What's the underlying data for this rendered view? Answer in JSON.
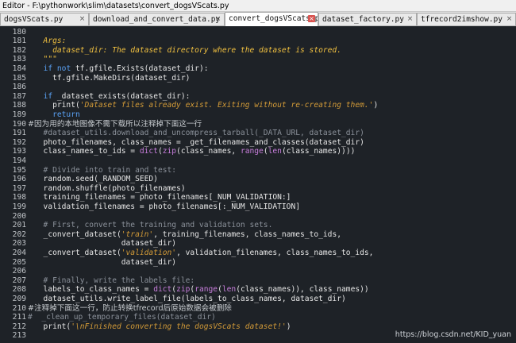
{
  "window": {
    "title": "Editor - F:\\pythonwork\\slim\\datasets\\convert_dogsVScats.py"
  },
  "tabs": [
    {
      "label": "dogsVScats.py",
      "active": false
    },
    {
      "label": "download_and_convert_data.py",
      "active": false
    },
    {
      "label": "convert_dogsVScats.py",
      "active": true
    },
    {
      "label": "dataset_factory.py",
      "active": false
    },
    {
      "label": "tfrecord2imshow.py",
      "active": false
    }
  ],
  "lines": [
    {
      "n": "180",
      "t": ""
    },
    {
      "n": "181",
      "t": "  Args:"
    },
    {
      "n": "182",
      "t": "    dataset_dir: The dataset directory where the dataset is stored."
    },
    {
      "n": "183",
      "t": "  \"\"\""
    },
    {
      "n": "184",
      "t": "  if not tf.gfile.Exists(dataset_dir):"
    },
    {
      "n": "185",
      "t": "    tf.gfile.MakeDirs(dataset_dir)"
    },
    {
      "n": "186",
      "t": ""
    },
    {
      "n": "187",
      "t": "  if _dataset_exists(dataset_dir):"
    },
    {
      "n": "188",
      "t": "    print('Dataset files already exist. Exiting without re-creating them.')"
    },
    {
      "n": "189",
      "t": "    return"
    },
    {
      "n": "190",
      "t": "#因为用的本地图像不需下载所以注释掉下面这一行"
    },
    {
      "n": "191",
      "t": "  #dataset_utils.download_and_uncompress_tarball(_DATA_URL, dataset_dir)"
    },
    {
      "n": "192",
      "t": "  photo_filenames, class_names = _get_filenames_and_classes(dataset_dir)"
    },
    {
      "n": "193",
      "t": "  class_names_to_ids = dict(zip(class_names, range(len(class_names))))"
    },
    {
      "n": "194",
      "t": ""
    },
    {
      "n": "195",
      "t": "  # Divide into train and test:"
    },
    {
      "n": "196",
      "t": "  random.seed(_RANDOM_SEED)"
    },
    {
      "n": "197",
      "t": "  random.shuffle(photo_filenames)"
    },
    {
      "n": "198",
      "t": "  training_filenames = photo_filenames[_NUM_VALIDATION:]"
    },
    {
      "n": "199",
      "t": "  validation_filenames = photo_filenames[:_NUM_VALIDATION]"
    },
    {
      "n": "200",
      "t": ""
    },
    {
      "n": "201",
      "t": "  # First, convert the training and validation sets."
    },
    {
      "n": "202",
      "t": "  _convert_dataset('train', training_filenames, class_names_to_ids,"
    },
    {
      "n": "203",
      "t": "                   dataset_dir)"
    },
    {
      "n": "204",
      "t": "  _convert_dataset('validation', validation_filenames, class_names_to_ids,"
    },
    {
      "n": "205",
      "t": "                   dataset_dir)"
    },
    {
      "n": "206",
      "t": ""
    },
    {
      "n": "207",
      "t": "  # Finally, write the labels file:"
    },
    {
      "n": "208",
      "t": "  labels_to_class_names = dict(zip(range(len(class_names)), class_names))"
    },
    {
      "n": "209",
      "t": "  dataset_utils.write_label_file(labels_to_class_names, dataset_dir)"
    },
    {
      "n": "210",
      "t": "#注释掉下面这一行，防止转换tfrecord后原始数据会被删除"
    },
    {
      "n": "211",
      "t": "#  _clean_up_temporary_files(dataset_dir)"
    },
    {
      "n": "212",
      "t": "  print('\\nFinished converting the dogsVScats dataset!')"
    },
    {
      "n": "213",
      "t": ""
    }
  ],
  "watermark": "https://blog.csdn.net/KID_yuan",
  "colors": {
    "background": "#1e2227",
    "keyword": "#5aa2f5",
    "string": "#d39b38",
    "comment": "#8a9099",
    "docstring": "#f0c040",
    "builtin": "#c77ddb",
    "close_button": "#d9534f"
  }
}
